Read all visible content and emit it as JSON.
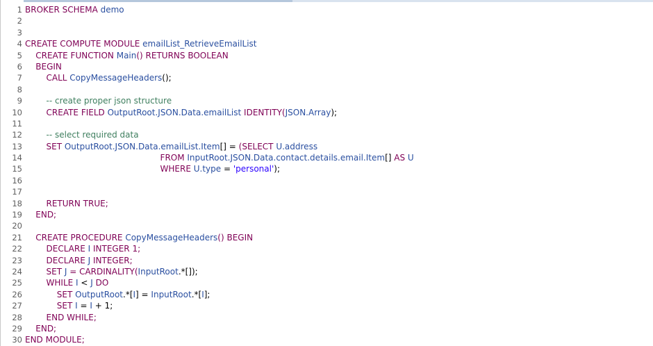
{
  "editor": {
    "lines": [
      {
        "n": "1",
        "tokens": [
          {
            "t": "BROKER SCHEMA ",
            "c": "kw"
          },
          {
            "t": "demo",
            "c": "id"
          }
        ]
      },
      {
        "n": "2",
        "tokens": []
      },
      {
        "n": "3",
        "tokens": []
      },
      {
        "n": "4",
        "tokens": [
          {
            "t": "CREATE COMPUTE MODULE ",
            "c": "kw"
          },
          {
            "t": "emailList_RetrieveEmailList",
            "c": "id"
          }
        ]
      },
      {
        "n": "5",
        "tokens": [
          {
            "t": "    CREATE FUNCTION ",
            "c": "kw"
          },
          {
            "t": "Main",
            "c": "id"
          },
          {
            "t": "() RETURNS BOOLEAN",
            "c": "kw"
          }
        ]
      },
      {
        "n": "6",
        "tokens": [
          {
            "t": "    BEGIN",
            "c": "kw"
          }
        ]
      },
      {
        "n": "7",
        "tokens": [
          {
            "t": "        CALL ",
            "c": "kw"
          },
          {
            "t": "CopyMessageHeaders",
            "c": "id"
          },
          {
            "t": "();",
            "c": "pl"
          }
        ]
      },
      {
        "n": "8",
        "tokens": []
      },
      {
        "n": "9",
        "tokens": [
          {
            "t": "        -- create proper json structure",
            "c": "cm"
          }
        ]
      },
      {
        "n": "10",
        "tokens": [
          {
            "t": "        CREATE FIELD ",
            "c": "kw"
          },
          {
            "t": "OutputRoot.JSON.Data.emailList",
            "c": "id"
          },
          {
            "t": " IDENTITY(",
            "c": "kw"
          },
          {
            "t": "JSON.Array",
            "c": "id"
          },
          {
            "t": ");",
            "c": "pl"
          }
        ]
      },
      {
        "n": "11",
        "tokens": []
      },
      {
        "n": "12",
        "tokens": [
          {
            "t": "        -- select required data",
            "c": "cm"
          }
        ]
      },
      {
        "n": "13",
        "tokens": [
          {
            "t": "        SET ",
            "c": "kw"
          },
          {
            "t": "OutputRoot.JSON.Data.emailList.Item",
            "c": "id"
          },
          {
            "t": "[] = ",
            "c": "pl"
          },
          {
            "t": "(SELECT ",
            "c": "kw"
          },
          {
            "t": "U.address",
            "c": "id"
          }
        ]
      },
      {
        "n": "14",
        "tokens": [
          {
            "t": "                                                   FROM ",
            "c": "kw"
          },
          {
            "t": "InputRoot.JSON.Data.contact.details.email.Item",
            "c": "id"
          },
          {
            "t": "[] ",
            "c": "pl"
          },
          {
            "t": "AS ",
            "c": "kw"
          },
          {
            "t": "U",
            "c": "id"
          }
        ]
      },
      {
        "n": "15",
        "tokens": [
          {
            "t": "                                                   WHERE ",
            "c": "kw"
          },
          {
            "t": "U.type",
            "c": "id"
          },
          {
            "t": " = ",
            "c": "pl"
          },
          {
            "t": "'personal'",
            "c": "st"
          },
          {
            "t": ");",
            "c": "pl"
          }
        ]
      },
      {
        "n": "16",
        "tokens": []
      },
      {
        "n": "17",
        "tokens": []
      },
      {
        "n": "18",
        "tokens": [
          {
            "t": "        RETURN TRUE;",
            "c": "kw"
          }
        ]
      },
      {
        "n": "19",
        "tokens": [
          {
            "t": "    END;",
            "c": "kw"
          }
        ]
      },
      {
        "n": "20",
        "tokens": []
      },
      {
        "n": "21",
        "tokens": [
          {
            "t": "    CREATE PROCEDURE ",
            "c": "kw"
          },
          {
            "t": "CopyMessageHeaders",
            "c": "id"
          },
          {
            "t": "() BEGIN",
            "c": "kw"
          }
        ]
      },
      {
        "n": "22",
        "tokens": [
          {
            "t": "        DECLARE ",
            "c": "kw"
          },
          {
            "t": "I",
            "c": "id"
          },
          {
            "t": " INTEGER 1;",
            "c": "kw"
          }
        ]
      },
      {
        "n": "23",
        "tokens": [
          {
            "t": "        DECLARE ",
            "c": "kw"
          },
          {
            "t": "J",
            "c": "id"
          },
          {
            "t": " INTEGER;",
            "c": "kw"
          }
        ]
      },
      {
        "n": "24",
        "tokens": [
          {
            "t": "        SET ",
            "c": "kw"
          },
          {
            "t": "J",
            "c": "id"
          },
          {
            "t": " = CARDINALITY(",
            "c": "kw"
          },
          {
            "t": "InputRoot",
            "c": "id"
          },
          {
            "t": ".*[]);",
            "c": "pl"
          }
        ]
      },
      {
        "n": "25",
        "tokens": [
          {
            "t": "        WHILE ",
            "c": "kw"
          },
          {
            "t": "I",
            "c": "id"
          },
          {
            "t": " < ",
            "c": "pl"
          },
          {
            "t": "J",
            "c": "id"
          },
          {
            "t": " DO",
            "c": "kw"
          }
        ]
      },
      {
        "n": "26",
        "tokens": [
          {
            "t": "            SET ",
            "c": "kw"
          },
          {
            "t": "OutputRoot",
            "c": "id"
          },
          {
            "t": ".*[",
            "c": "pl"
          },
          {
            "t": "I",
            "c": "id"
          },
          {
            "t": "] = ",
            "c": "pl"
          },
          {
            "t": "InputRoot",
            "c": "id"
          },
          {
            "t": ".*[",
            "c": "pl"
          },
          {
            "t": "I",
            "c": "id"
          },
          {
            "t": "];",
            "c": "pl"
          }
        ]
      },
      {
        "n": "27",
        "tokens": [
          {
            "t": "            SET ",
            "c": "kw"
          },
          {
            "t": "I",
            "c": "id"
          },
          {
            "t": " = ",
            "c": "pl"
          },
          {
            "t": "I",
            "c": "id"
          },
          {
            "t": " + 1;",
            "c": "pl"
          }
        ]
      },
      {
        "n": "28",
        "tokens": [
          {
            "t": "        END WHILE;",
            "c": "kw"
          }
        ]
      },
      {
        "n": "29",
        "tokens": [
          {
            "t": "    END;",
            "c": "kw"
          }
        ]
      },
      {
        "n": "30",
        "tokens": [
          {
            "t": "END MODULE;",
            "c": "kw"
          }
        ]
      }
    ]
  }
}
